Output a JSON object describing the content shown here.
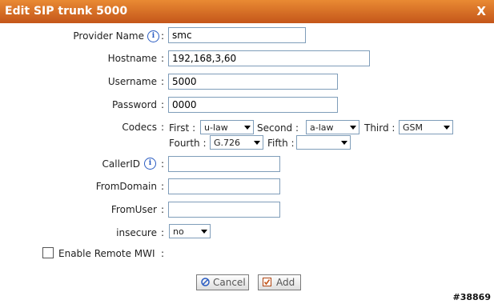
{
  "dialog": {
    "title": "Edit SIP trunk 5000",
    "close_label": "X"
  },
  "form": {
    "provider_name": {
      "label": "Provider Name",
      "value": "smc"
    },
    "hostname": {
      "label": "Hostname",
      "value": "192,168,3,60"
    },
    "username": {
      "label": "Username",
      "value": "5000"
    },
    "password": {
      "label": "Password",
      "value": "0000"
    },
    "codecs": {
      "label": "Codecs",
      "first": {
        "label": "First :",
        "value": "u-law"
      },
      "second": {
        "label": "Second :",
        "value": "a-law"
      },
      "third": {
        "label": "Third :",
        "value": "GSM"
      },
      "fourth": {
        "label": "Fourth :",
        "value": "G.726"
      },
      "fifth": {
        "label": "Fifth :",
        "value": ""
      }
    },
    "callerid": {
      "label": "CallerID",
      "value": ""
    },
    "fromdomain": {
      "label": "FromDomain",
      "value": ""
    },
    "fromuser": {
      "label": "FromUser",
      "value": ""
    },
    "insecure": {
      "label": "insecure",
      "value": "no"
    },
    "enable_remote_mwi": {
      "label": "Enable Remote MWI",
      "checked": false
    }
  },
  "colon": ":",
  "buttons": {
    "cancel": "Cancel",
    "add": "Add"
  },
  "watermark": "#38869"
}
